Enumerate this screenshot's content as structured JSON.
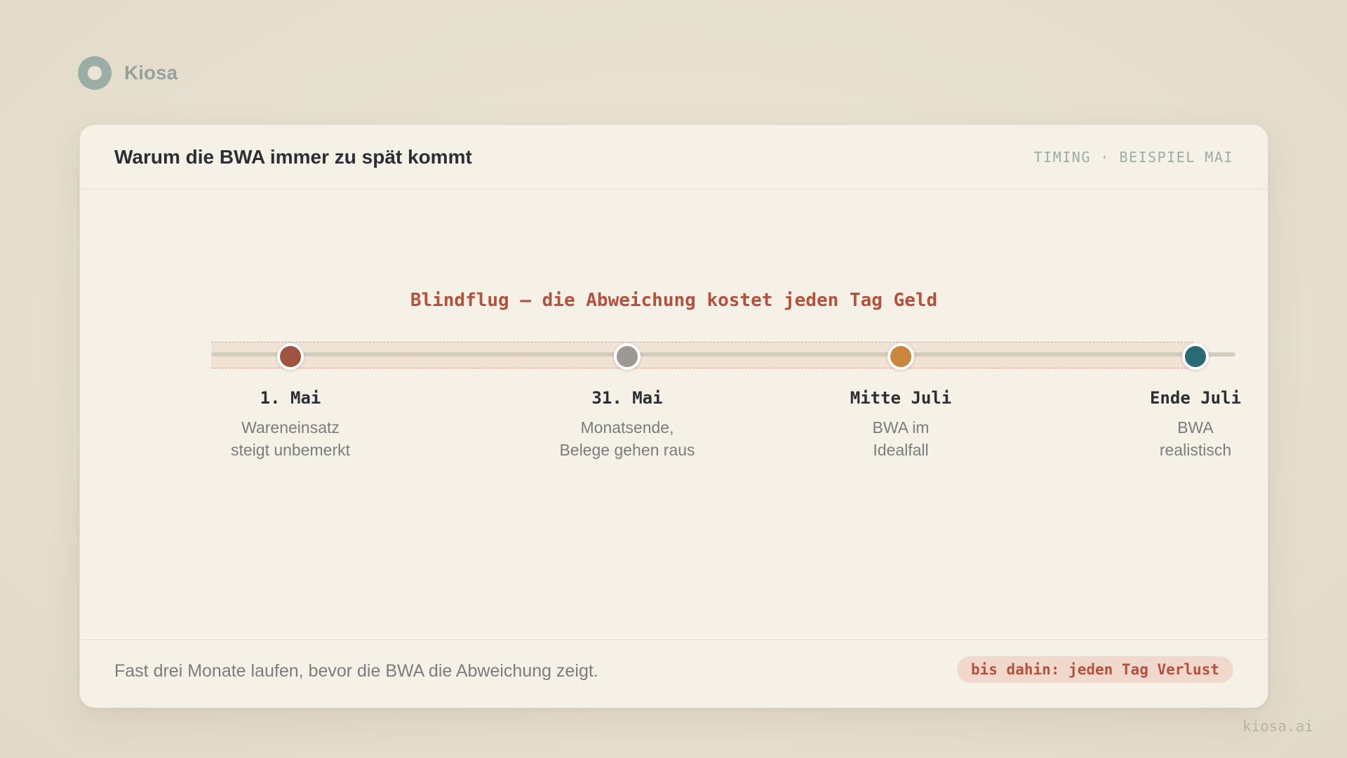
{
  "brand": {
    "name": "Kiosa"
  },
  "card": {
    "title": "Warum die BWA immer zu spät kommt",
    "tag": "TIMING · BEISPIEL MAI",
    "banner": "Blindflug — die Abweichung kostet jeden Tag Geld",
    "milestones": [
      {
        "label": "1. Mai",
        "desc_lines": [
          "Wareneinsatz",
          "steigt unbemerkt"
        ],
        "color": "#a0533e"
      },
      {
        "label": "31. Mai",
        "desc_lines": [
          "Monatsende,",
          "Belege gehen raus"
        ],
        "color": "#9e9893"
      },
      {
        "label": "Mitte Juli",
        "desc_lines": [
          "BWA im",
          "Idealfall"
        ],
        "color": "#c8873a"
      },
      {
        "label": "Ende Juli",
        "desc_lines": [
          "BWA",
          "realistisch"
        ],
        "color": "#2a6a72"
      }
    ],
    "footer_text": "Fast drei Monate laufen, bevor die BWA die Abweichung zeigt.",
    "footer_badge": "bis dahin: jeden Tag Verlust"
  },
  "watermark": "kiosa.ai"
}
